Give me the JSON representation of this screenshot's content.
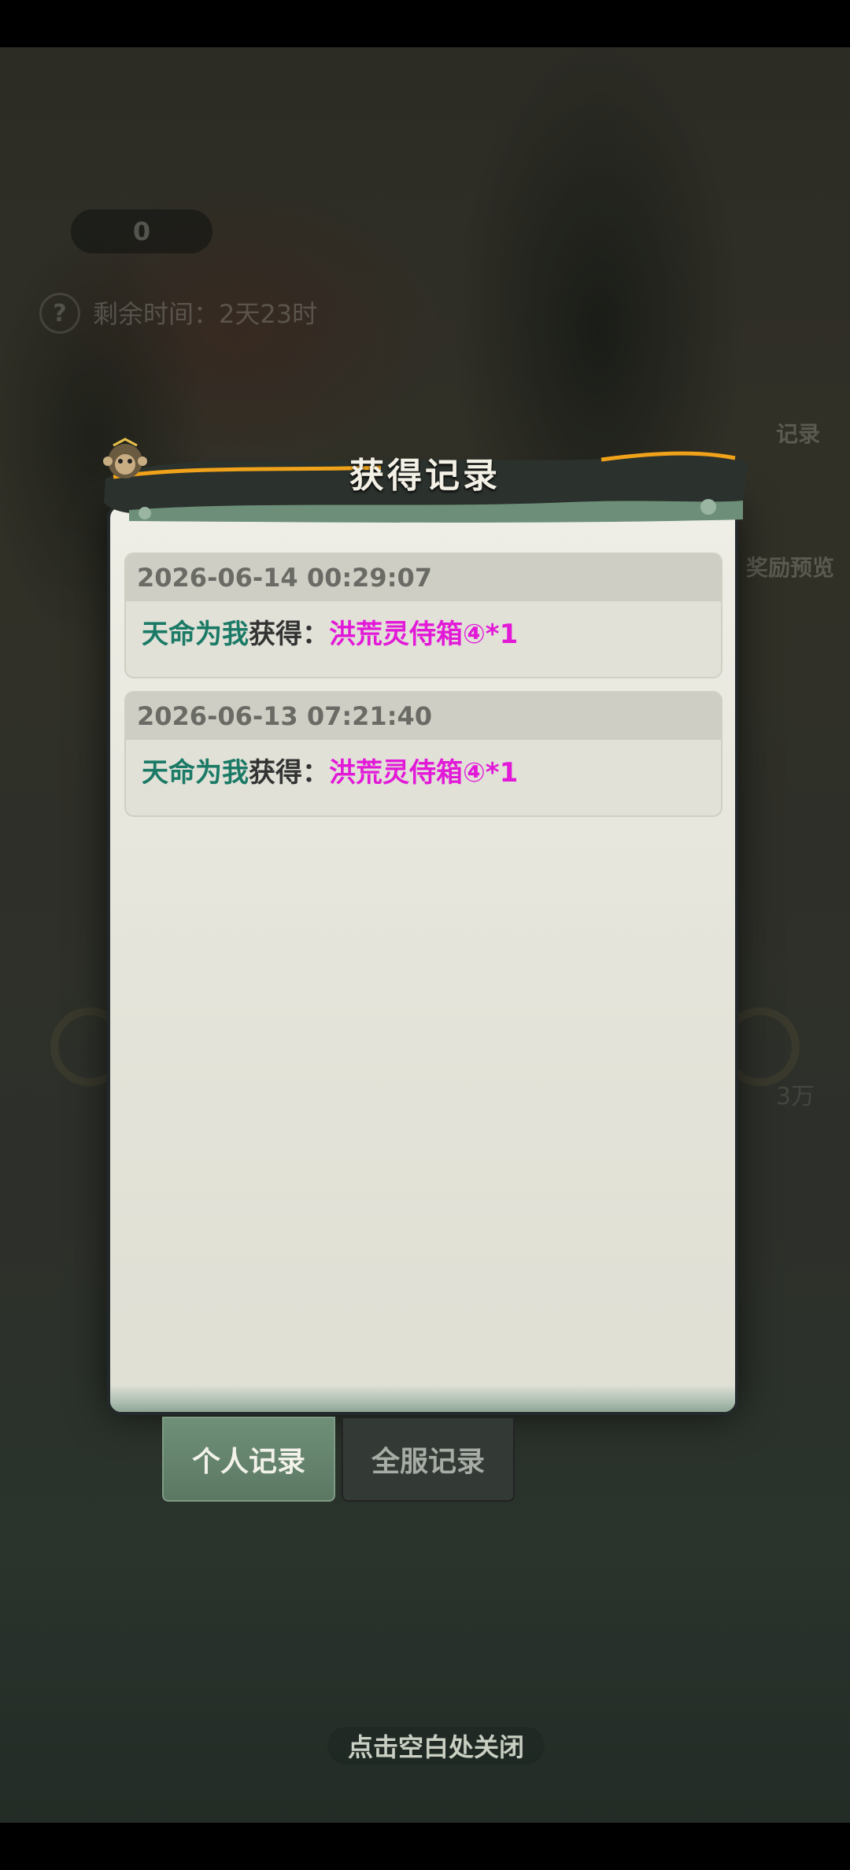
{
  "background": {
    "counter_value": "0",
    "timer_text": "剩余时间：2天23时",
    "help_glyph": "?",
    "side_record_label": "记录",
    "side_reward_label": "奖励预览",
    "bg_price_label": "3万"
  },
  "dialog": {
    "title": "获得记录",
    "records": [
      {
        "time": "2026-06-14 00:29:07",
        "player": "天命为我",
        "verb": "获得：",
        "item": "洪荒灵侍箱④*1"
      },
      {
        "time": "2026-06-13 07:21:40",
        "player": "天命为我",
        "verb": "获得：",
        "item": "洪荒灵侍箱④*1"
      }
    ]
  },
  "tabs": {
    "personal": "个人记录",
    "server": "全服记录",
    "active": "personal"
  },
  "close_hint": "点击空白处关闭",
  "colors": {
    "player_name": "#1b7a66",
    "item_name": "#e21ad8",
    "active_tab": "#6f8f78"
  }
}
